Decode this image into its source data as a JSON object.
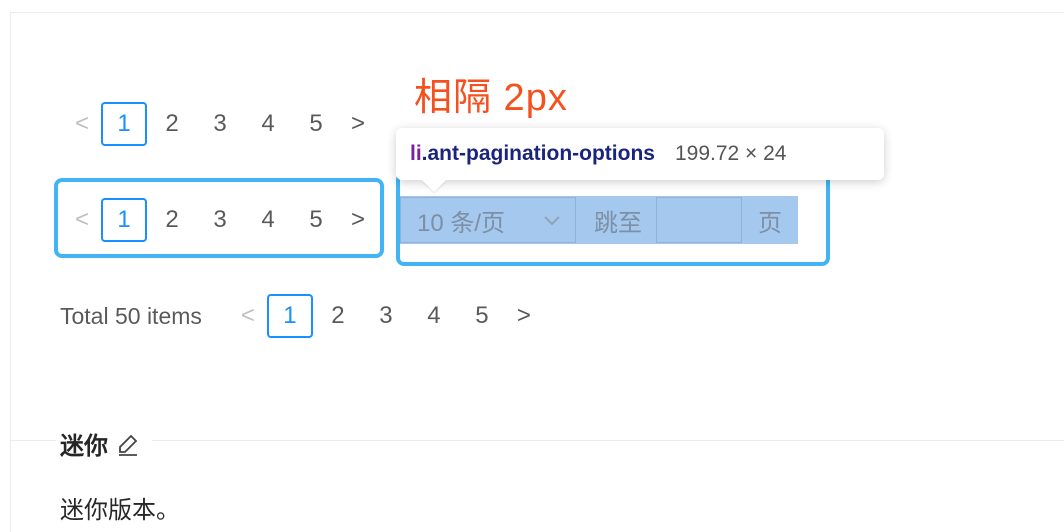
{
  "pagination_rows": {
    "pages": [
      "1",
      "2",
      "3",
      "4",
      "5"
    ],
    "prev_glyph": "<",
    "next_glyph": ">",
    "total_label": "Total 50 items"
  },
  "annotation": {
    "text": "相隔 2px"
  },
  "tooltip": {
    "tag": "li",
    "class_name": ".ant-pagination-options",
    "size": "199.72 × 24"
  },
  "options": {
    "size_changer": "10 条/页",
    "jump_label": "跳至",
    "page_suffix": "页"
  },
  "demo": {
    "title": "迷你",
    "description": "迷你版本。"
  },
  "colors": {
    "accent": "#1890ff",
    "highlight_border": "#42b4f5",
    "annotation": "#f4511e",
    "selection_overlay": "#a5c8ee"
  }
}
